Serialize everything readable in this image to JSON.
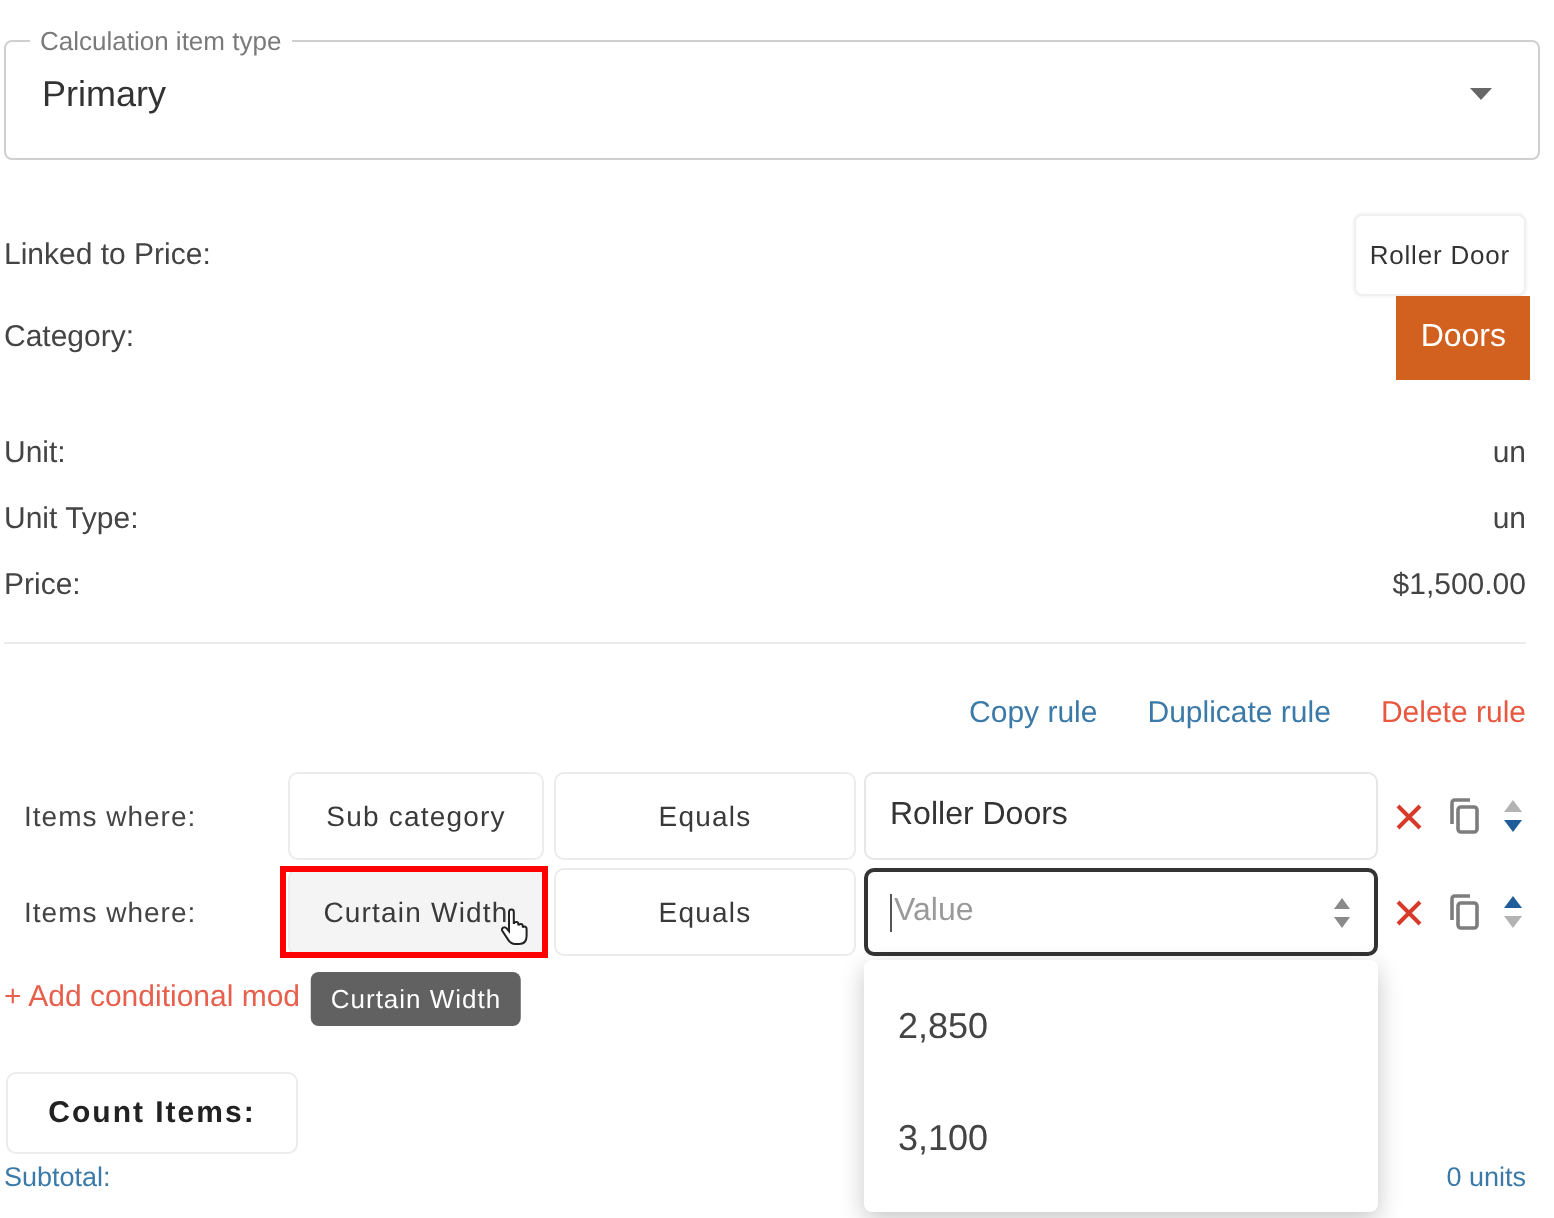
{
  "type_select": {
    "label": "Calculation item type",
    "value": "Primary"
  },
  "details": [
    {
      "label": "Linked to Price:",
      "kind": "chip",
      "value": "Roller Door"
    },
    {
      "label": "Category:",
      "kind": "tag",
      "value": "Doors",
      "color": "#d2601f"
    },
    {
      "label": "Unit:",
      "kind": "text",
      "value": "un"
    },
    {
      "label": "Unit Type:",
      "kind": "text",
      "value": "un"
    },
    {
      "label": "Price:",
      "kind": "text",
      "value": "$1,500.00"
    }
  ],
  "rule_actions": [
    {
      "label": "Copy rule",
      "kind": "link"
    },
    {
      "label": "Duplicate rule",
      "kind": "link"
    },
    {
      "label": "Delete rule",
      "kind": "danger"
    }
  ],
  "conditions": [
    {
      "label": "Items where:",
      "field": "Sub category",
      "field_hovered": false,
      "field_annotated": false,
      "operator": "Equals",
      "kind": "text",
      "value": "Roller Doors",
      "focused": false,
      "expanded": false,
      "can_move_up": false,
      "can_move_down": true
    },
    {
      "label": "Items where:",
      "field": "Curtain Width",
      "field_hovered": true,
      "field_annotated": true,
      "tooltip": "Curtain Width",
      "operator": "Equals",
      "kind": "select",
      "placeholder": "Value",
      "focused": true,
      "expanded": true,
      "options": [
        "2,850",
        "3,100"
      ],
      "can_move_up": true,
      "can_move_down": false
    }
  ],
  "add_condition": {
    "label": "+ Add conditional mod"
  },
  "count_button": {
    "label": "Count Items:"
  },
  "subtotal": {
    "label": "Subtotal:",
    "value": "0 units"
  }
}
